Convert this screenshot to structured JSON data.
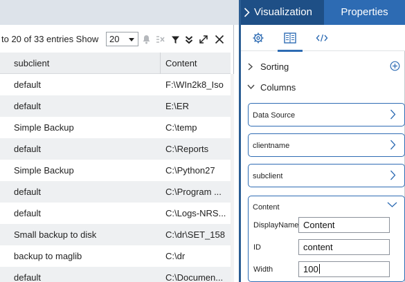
{
  "table": {
    "entries_text": "to 20 of 33 entries Show",
    "page_size": "20",
    "columns": [
      "subclient",
      "Content"
    ],
    "rows": [
      [
        "default",
        "F:\\WIn2k8_Iso"
      ],
      [
        "default",
        "E:\\ER"
      ],
      [
        "Simple Backup",
        "C:\\temp"
      ],
      [
        "default",
        "C:\\Reports"
      ],
      [
        "Simple Backup",
        "C:\\Python27"
      ],
      [
        "default",
        "C:\\Program ..."
      ],
      [
        "default",
        "C:\\Logs-NRS..."
      ],
      [
        "Small backup to disk",
        "C:\\dr\\SET_158"
      ],
      [
        "backup to maglib",
        "C:\\dr"
      ],
      [
        "default",
        "C:\\Documen..."
      ]
    ],
    "toolbar_icons": [
      "bell-icon",
      "clear-filter-icon",
      "filter-icon",
      "chevrons-down-icon",
      "expand-icon",
      "close-icon"
    ]
  },
  "panel": {
    "tabs": {
      "visualization": "Visualization",
      "properties": "Properties"
    },
    "subtabs": [
      "gear-icon",
      "columns-icon",
      "code-icon"
    ],
    "sorting_label": "Sorting",
    "columns_label": "Columns",
    "column_items": [
      "Data Source",
      "clientname",
      "subclient"
    ],
    "content_item": {
      "title": "Content",
      "display_name_label": "DisplayName",
      "display_name_value": "Content",
      "id_label": "ID",
      "id_value": "content",
      "width_label": "Width",
      "width_value": "100"
    }
  },
  "colors": {
    "tabbar": "#1e4f86",
    "active_tab": "#2d6bb3",
    "accent": "#2d6bb3",
    "alt_row": "#eef0f2"
  }
}
